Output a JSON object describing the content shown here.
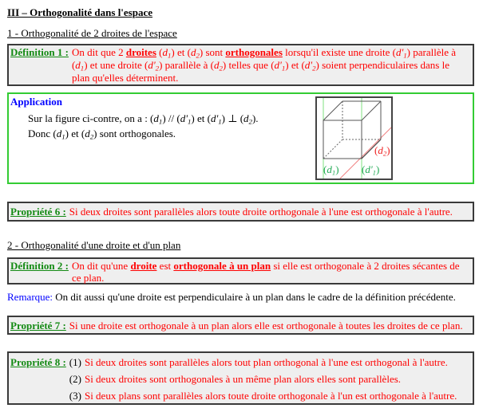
{
  "colors": {
    "red_text": "#ff0000",
    "label_green": "#138a13",
    "blue": "#0000ff",
    "box_bg": "#efefef",
    "application_border": "#33cc33",
    "figure_green": "#22aa55",
    "figure_red": "#ee2222"
  },
  "header": {
    "title": "III – Orthogonalité dans l'espace"
  },
  "section1": {
    "title": "1 - Orthogonalité de 2 droites de l'espace",
    "definition1": {
      "label": "Définition 1 :",
      "text": [
        "On dit que 2 ",
        {
          "t": "droites",
          "bu": true
        },
        " (",
        {
          "t": "d",
          "sub": "1",
          "i": true
        },
        ") et (",
        {
          "t": "d",
          "sub": "2",
          "i": true
        },
        ") sont ",
        {
          "t": "orthogonales",
          "bu": true
        },
        " lorsqu'il existe une droite (",
        {
          "t": "d'",
          "sub": "1",
          "i": true
        },
        ") parallèle à (",
        {
          "t": "d",
          "sub": "1",
          "i": true
        },
        ") et une droite (",
        {
          "t": "d'",
          "sub": "2",
          "i": true
        },
        ") parallèle à (",
        {
          "t": "d",
          "sub": "2",
          "i": true
        },
        ") telles que (",
        {
          "t": "d'",
          "sub": "1",
          "i": true
        },
        ") et (",
        {
          "t": "d'",
          "sub": "2",
          "i": true
        },
        ") soient perpendiculaires dans le plan qu'elles déterminent."
      ]
    },
    "application": {
      "title": "Application",
      "lines": [
        [
          "Sur la figure ci-contre, on a : (",
          {
            "t": "d",
            "sub": "1",
            "i": true
          },
          ") // (",
          {
            "t": "d'",
            "sub": "1",
            "i": true
          },
          ") et (",
          {
            "t": "d'",
            "sub": "1",
            "i": true
          },
          ") ⊥ (",
          {
            "t": "d",
            "sub": "2",
            "i": true
          },
          ")."
        ],
        [
          "Donc (",
          {
            "t": "d",
            "sub": "1",
            "i": true
          },
          ") et (",
          {
            "t": "d",
            "sub": "2",
            "i": true
          },
          ") sont orthogonales."
        ]
      ],
      "figure": {
        "label_d1": [
          "(",
          {
            "t": "d",
            "sub": "1",
            "i": true
          },
          ")"
        ],
        "label_d1_prime": [
          "(",
          {
            "t": "d'",
            "sub": "1",
            "i": true
          },
          ")"
        ],
        "label_d2": [
          "(",
          {
            "t": "d",
            "sub": "2",
            "i": true
          },
          ")"
        ]
      }
    },
    "property6": {
      "label": "Propriété 6 :",
      "text": "Si deux droites sont parallèles alors toute droite orthogonale à l'une est orthogonale à l'autre."
    }
  },
  "section2": {
    "title": "2 - Orthogonalité d'une droite et d'un plan",
    "definition2": {
      "label": "Définition 2 :",
      "text": [
        "On dit qu'une ",
        {
          "t": "droite",
          "bu": true
        },
        " est ",
        {
          "t": "orthogonale à un plan",
          "bu": true
        },
        " si elle est orthogonale à 2 droites sécantes de ce plan."
      ]
    },
    "remark": {
      "label": "Remarque:",
      "text": " On dit aussi qu'une droite est perpendiculaire à un plan dans le cadre de la définition précédente."
    },
    "property7": {
      "label": "Propriété 7 :",
      "text": "Si une droite est orthogonale à un plan alors elle est orthogonale à toutes les droites de ce plan."
    },
    "property8": {
      "label": "Propriété 8 :",
      "items": [
        {
          "num": "(1)",
          "text": "Si deux droites sont parallèles alors tout plan orthogonal à l'une est orthogonal à l'autre."
        },
        {
          "num": "(2)",
          "text": "Si deux droites sont orthogonales à un même plan alors elles sont parallèles."
        },
        {
          "num": "(3)",
          "text": "Si deux plans sont parallèles alors toute droite orthogonale à l'un est orthogonale à l'autre."
        }
      ]
    }
  }
}
